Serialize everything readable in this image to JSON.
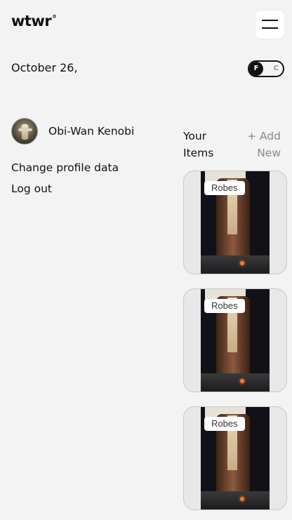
{
  "header": {
    "logo": "wtwr",
    "logo_mark": "°",
    "menu_icon": "hamburger-menu-icon",
    "date": "October 26,",
    "temp_toggle": {
      "active": "F",
      "inactive": "C"
    }
  },
  "sidebar": {
    "username": "Obi-Wan Kenobi",
    "avatar_icon": "user-avatar",
    "change_profile": "Change profile data",
    "logout": "Log out"
  },
  "items": {
    "title": "Your Items",
    "add_new": "+ Add New",
    "cards": [
      {
        "label": "Robes",
        "liked": false
      },
      {
        "label": "Robes",
        "liked": false
      },
      {
        "label": "Robes",
        "liked": true
      }
    ]
  }
}
